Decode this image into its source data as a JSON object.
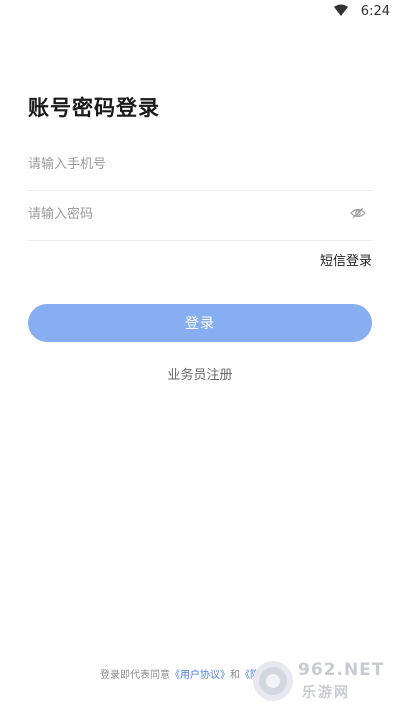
{
  "status_bar": {
    "time": "6:24"
  },
  "login": {
    "title": "账号密码登录",
    "phone_placeholder": "请输入手机号",
    "password_placeholder": "请输入密码",
    "sms_login_label": "短信登录",
    "login_button_label": "登录",
    "register_label": "业务员注册"
  },
  "agreement": {
    "prefix": "登录即代表同意",
    "user_agreement": "《用户协议》",
    "conjunction": "和",
    "privacy_partial": "《隐私"
  },
  "watermark": {
    "text": "962.NET",
    "sub": "乐游网"
  },
  "colors": {
    "accent": "#87aef0",
    "link": "#4a7fd6"
  }
}
